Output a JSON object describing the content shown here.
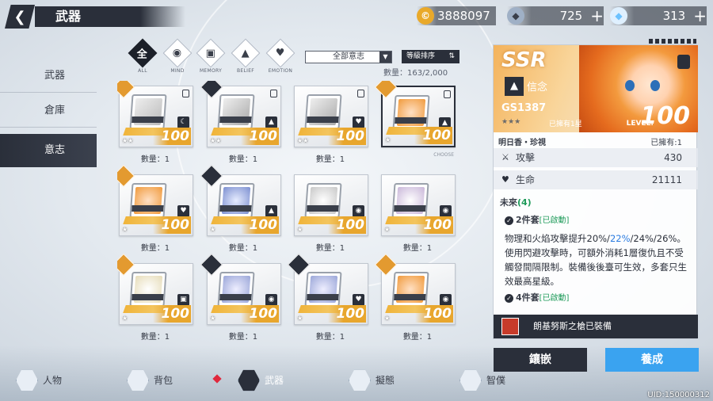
{
  "header": {
    "back_icon": "back-arrow-icon",
    "title": "武器"
  },
  "currencies": [
    {
      "icon": "coin-icon",
      "value": "3888097"
    },
    {
      "icon": "crystal-shard-icon",
      "value": "725",
      "plus": "+"
    },
    {
      "icon": "diamond-icon",
      "value": "313",
      "plus": "+"
    }
  ],
  "sidebar": {
    "items": [
      {
        "label": "武器"
      },
      {
        "label": "倉庫"
      },
      {
        "label": "意志"
      }
    ]
  },
  "filters": {
    "tabs": [
      {
        "glyph": "全",
        "label": "ALL"
      },
      {
        "glyph": "◉",
        "label": "MIND"
      },
      {
        "glyph": "▣",
        "label": "MEMORY"
      },
      {
        "glyph": "▲",
        "label": "BELIEF"
      },
      {
        "glyph": "♥",
        "label": "EMOTION"
      }
    ],
    "dropdown": "全部意志",
    "sort": "等級排序",
    "count": "數量：163/2,000"
  },
  "grid": {
    "items": [
      {
        "level": "100",
        "qty": "數量：1",
        "stars": "★★",
        "type": "☾"
      },
      {
        "level": "100",
        "qty": "數量：1",
        "stars": "★★",
        "type": "▲"
      },
      {
        "level": "100",
        "qty": "數量：1",
        "stars": "★★",
        "type": "♥"
      },
      {
        "level": "100",
        "qty": "",
        "stars": "★",
        "type": "▲",
        "selected_tag": "CHOOSE"
      },
      {
        "level": "100",
        "qty": "數量：1",
        "stars": "★",
        "type": "♥"
      },
      {
        "level": "100",
        "qty": "數量：1",
        "stars": "★",
        "type": "▲"
      },
      {
        "level": "100",
        "qty": "數量：1",
        "stars": "★",
        "type": "◉"
      },
      {
        "level": "100",
        "qty": "數量：1",
        "stars": "★",
        "type": "◉"
      },
      {
        "level": "100",
        "qty": "數量：1",
        "stars": "★",
        "type": "▣"
      },
      {
        "level": "100",
        "qty": "數量：1",
        "stars": "★",
        "type": "◉"
      },
      {
        "level": "100",
        "qty": "數量：1",
        "stars": "★",
        "type": "♥"
      },
      {
        "level": "100",
        "qty": "數量：1",
        "stars": "★",
        "type": "◉"
      }
    ]
  },
  "detail": {
    "rarity": "SSR",
    "belief": "信念",
    "code": "GS1387",
    "owned_label": "已擁有1星",
    "level_label": "LEVEL:",
    "level": "100",
    "name": "明日香・珍視",
    "owned": "已擁有:1",
    "stats": [
      {
        "icon": "sword-icon",
        "label": "攻擊",
        "value": "430"
      },
      {
        "icon": "heart-icon",
        "label": "生命",
        "value": "21111"
      }
    ],
    "future_label": "未來",
    "future_count": "(4)",
    "set2": "2件套",
    "set2_state": "[已啟動]",
    "desc_a": "物理和火焰攻擊提升20%/",
    "desc_hl": "22%",
    "desc_b": "/24%/26%。使用閃避攻擊時，可額外消耗1層復仇且不受觸發間隔限制。裝備後後臺可生效，多套只生效最高星級。",
    "set4": "4件套",
    "set4_state": "[已啟動]",
    "equipped": "朗基努斯之槍已裝備"
  },
  "buttons": {
    "inlay": "鑲嵌",
    "train": "養成"
  },
  "bottom_tabs": [
    {
      "label": "人物"
    },
    {
      "label": "背包"
    },
    {
      "label": "武器"
    },
    {
      "label": "擬態"
    },
    {
      "label": "智僕"
    }
  ],
  "uid": "UID:150000312"
}
